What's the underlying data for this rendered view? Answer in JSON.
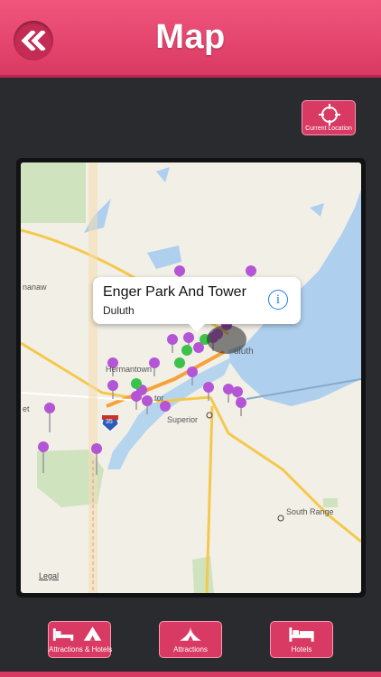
{
  "header": {
    "title": "Map",
    "back_icon": "double-chevron-left-icon"
  },
  "current_location": {
    "label": "Current Location",
    "icon": "crosshair-icon"
  },
  "map": {
    "callout": {
      "title": "Enger Park And Tower",
      "subtitle": "Duluth",
      "info_icon": "info-icon"
    },
    "labels": {
      "hermantown": "Hermantown",
      "superior": "Superior",
      "duluth": "uluth",
      "south_range": "South Range",
      "proctor": "tor",
      "west": "et",
      "nanaw": "nanaw",
      "highway": "35"
    },
    "legal": "Legal"
  },
  "tabs": [
    {
      "label": "Attractions & Hotels",
      "icon": "bed-and-tent-icon"
    },
    {
      "label": "Attractions",
      "icon": "tent-icon"
    },
    {
      "label": "Hotels",
      "icon": "bed-icon"
    }
  ],
  "colors": {
    "accent": "#d93a63",
    "pin_purple": "#b455d6",
    "pin_green": "#3cc24a",
    "water": "#aed0ee"
  }
}
